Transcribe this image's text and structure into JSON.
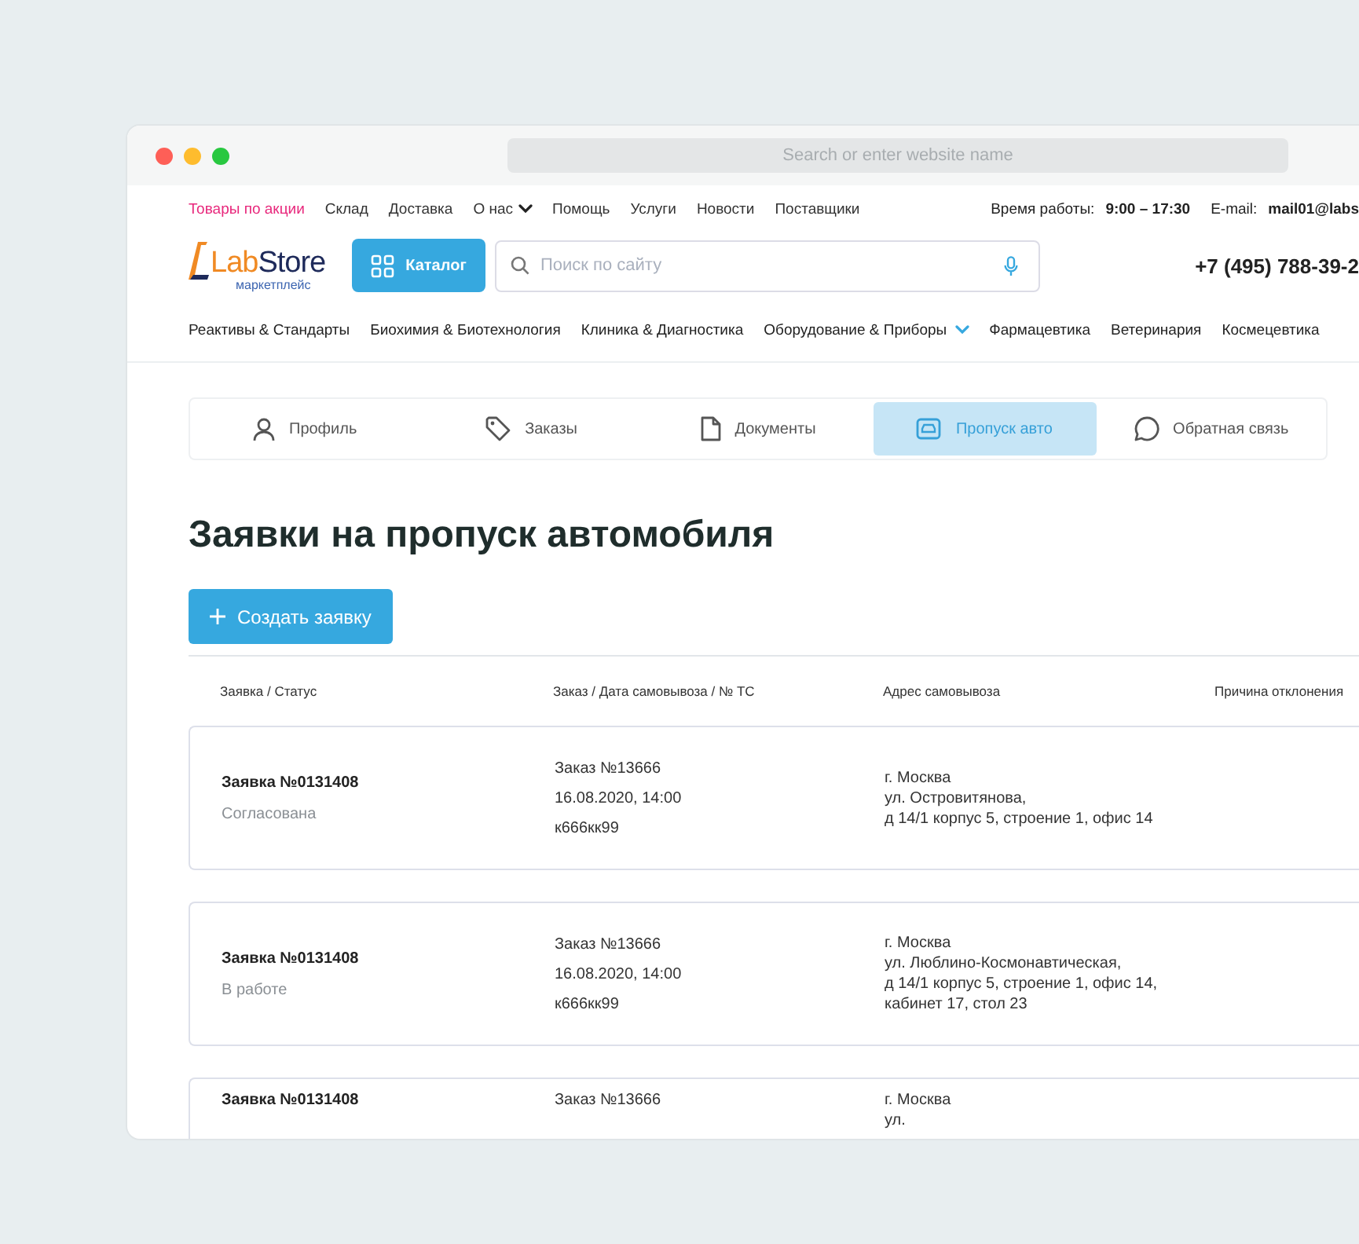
{
  "browser": {
    "address_placeholder": "Search or enter website name"
  },
  "top_nav": {
    "items": [
      {
        "label": "Товары по акции",
        "kind": "promo"
      },
      {
        "label": "Склад",
        "kind": "link"
      },
      {
        "label": "Доставка",
        "kind": "link"
      },
      {
        "label": "О нас",
        "kind": "dropdown"
      },
      {
        "label": "Помощь",
        "kind": "link"
      },
      {
        "label": "Услуги",
        "kind": "link"
      },
      {
        "label": "Новости",
        "kind": "link"
      },
      {
        "label": "Поставщики",
        "kind": "link"
      }
    ],
    "hours_label": "Время работы:",
    "hours": "9:00 – 17:30",
    "email_label": "E-mail:",
    "email": "mail01@labs"
  },
  "header": {
    "logo_parts": [
      "Lab",
      "Store"
    ],
    "logo_subtitle": "маркетплейс",
    "catalog_button": "Каталог",
    "search_placeholder": "Поиск по сайту",
    "phone": "+7 (495) 788-39-2"
  },
  "categories": [
    {
      "label": "Реактивы & Стандарты",
      "kind": "link"
    },
    {
      "label": "Биохимия & Биотехнология",
      "kind": "link"
    },
    {
      "label": "Клиника & Диагностика",
      "kind": "link"
    },
    {
      "label": "Оборудование & Приборы",
      "kind": "dropdown"
    },
    {
      "label": "Фармацевтика",
      "kind": "link"
    },
    {
      "label": "Ветеринария",
      "kind": "link"
    },
    {
      "label": "Космецевтика",
      "kind": "link"
    }
  ],
  "tabs": [
    {
      "label": "Профиль",
      "kind": "person",
      "selected": false
    },
    {
      "label": "Заказы",
      "kind": "tag",
      "selected": false
    },
    {
      "label": "Документы",
      "kind": "document",
      "selected": false
    },
    {
      "label": "Пропуск авто",
      "kind": "car",
      "selected": true
    },
    {
      "label": "Обратная связь",
      "kind": "chat",
      "selected": false
    }
  ],
  "page_title": "Заявки на пропуск автомобиля",
  "create_button": "Создать заявку",
  "table": {
    "columns": [
      "Заявка / Статус",
      "Заказ / Дата самовывоза / № ТС",
      "Адрес самовывоза",
      "Причина отклонения"
    ],
    "rows": [
      {
        "request": "Заявка №0131408",
        "status": "Согласована",
        "order_lines": [
          "Заказ №13666",
          "16.08.2020, 14:00",
          "к666кк99"
        ],
        "address_lines": [
          "г. Москва",
          "ул. Островитянова,",
          "д 14/1 корпус 5, строение 1, офис 14"
        ]
      },
      {
        "request": "Заявка №0131408",
        "status": "В работе",
        "order_lines": [
          "Заказ №13666",
          "16.08.2020, 14:00",
          "к666кк99"
        ],
        "address_lines": [
          "г. Москва",
          "ул. Люблино-Космонавтическая,",
          "д 14/1 корпус 5, строение 1, офис 14,",
          "кабинет 17, стол 23"
        ]
      },
      {
        "request": "Заявка №0131408",
        "order_lines": [
          "Заказ №13666"
        ],
        "address_lines": [
          "г. Москва",
          "ул."
        ]
      }
    ]
  }
}
